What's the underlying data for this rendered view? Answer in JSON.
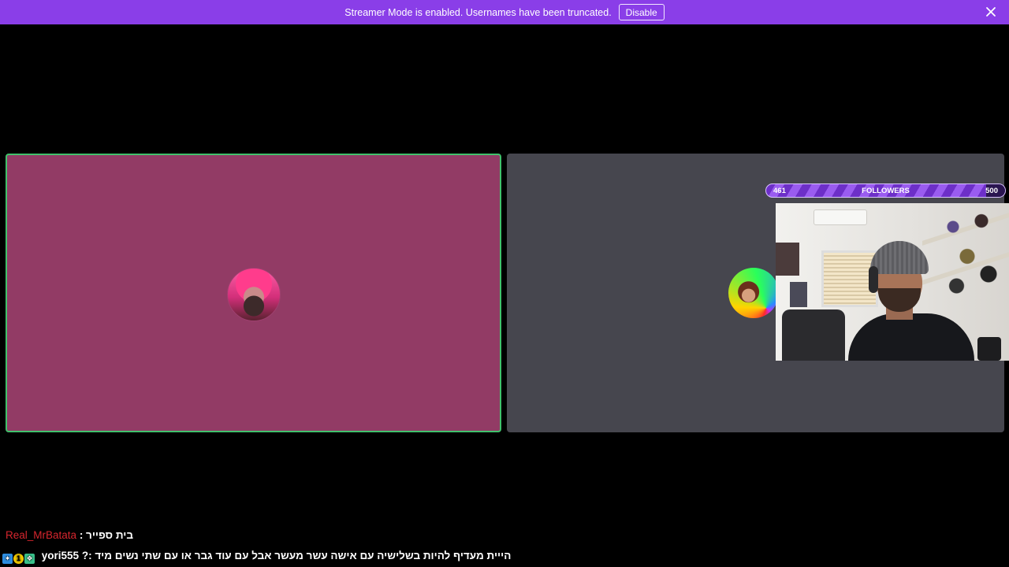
{
  "banner": {
    "text": "Streamer Mode is enabled. Usernames have been truncated.",
    "button_label": "Disable",
    "background_color": "#8a3ee8"
  },
  "tiles": {
    "left": {
      "background_color": "#923b65",
      "speaking_border_color": "#41c16c"
    },
    "right": {
      "background_color": "#46464e"
    }
  },
  "followers_goal": {
    "current": "461",
    "label": "FOLLOWERS",
    "target": "500",
    "progress": 0.922
  },
  "chat": {
    "messages": [
      {
        "username": "Real_MrBatata",
        "text": "בית ספייר :",
        "user_color": "#d7262e"
      },
      {
        "username": "yori555",
        "text": "הייית מעדיף להיות בשלישיה עם אישה עשר מעשר אבל עם עוד גבר או עם שתי נשים מיד :?",
        "user_color": "#ffffff",
        "badges": [
          "verified-badge-icon",
          "sub-badge-icon",
          "gift-badge-icon"
        ],
        "badge_glyphs": [
          "✦",
          "1",
          "❖"
        ]
      }
    ]
  }
}
